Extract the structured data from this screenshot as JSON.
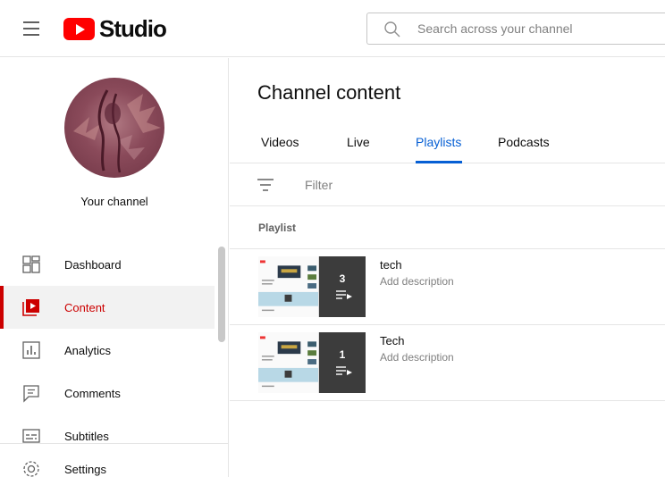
{
  "header": {
    "logo_text": "Studio",
    "search_placeholder": "Search across your channel",
    "brand_color": "#ff0000"
  },
  "sidebar": {
    "channel_label": "Your channel",
    "items": [
      {
        "label": "Dashboard",
        "icon": "dashboard-icon",
        "active": false
      },
      {
        "label": "Content",
        "icon": "content-icon",
        "active": true
      },
      {
        "label": "Analytics",
        "icon": "analytics-icon",
        "active": false
      },
      {
        "label": "Comments",
        "icon": "comments-icon",
        "active": false
      },
      {
        "label": "Subtitles",
        "icon": "subtitles-icon",
        "active": false
      }
    ],
    "settings_label": "Settings",
    "active_color": "#cc0000"
  },
  "main": {
    "title": "Channel content",
    "tabs": [
      {
        "label": "Videos",
        "active": false
      },
      {
        "label": "Live",
        "active": false
      },
      {
        "label": "Playlists",
        "active": true
      },
      {
        "label": "Podcasts",
        "active": false
      }
    ],
    "filter_placeholder": "Filter",
    "column_header": "Playlist",
    "accent_color": "#065fd4",
    "playlists": [
      {
        "title": "tech",
        "description": "Add description",
        "video_count": "3"
      },
      {
        "title": "Tech",
        "description": "Add description",
        "video_count": "1"
      }
    ]
  }
}
